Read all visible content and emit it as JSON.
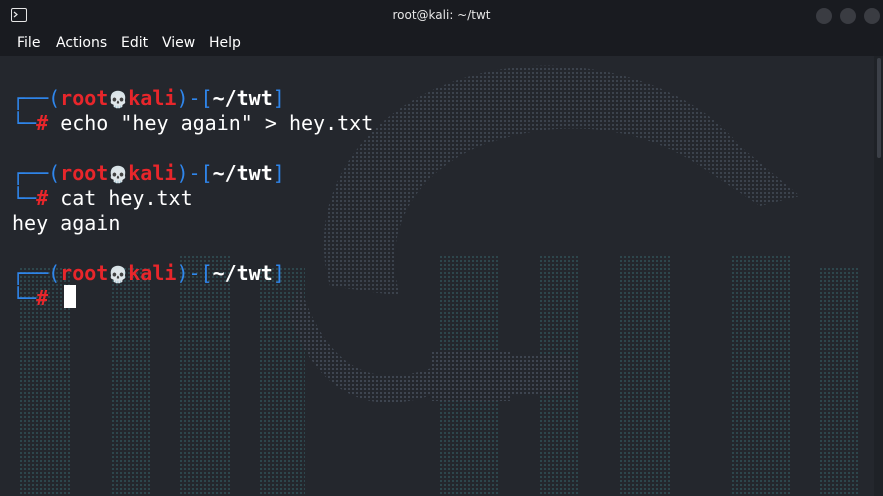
{
  "window": {
    "title": "root@kali: ~/twt"
  },
  "menu": [
    "File",
    "Actions",
    "Edit",
    "View",
    "Help"
  ],
  "prompt": {
    "user": "root",
    "skull": "💀",
    "host": "kali",
    "dir": "~/twt",
    "symbol": "#"
  },
  "lines": [
    {
      "type": "prompt",
      "command": "echo \"hey again\" > hey.txt"
    },
    {
      "type": "prompt",
      "command": "cat hey.txt"
    },
    {
      "type": "output",
      "text": "hey again"
    },
    {
      "type": "prompt",
      "command": ""
    }
  ],
  "commands": {
    "cmd1": "echo \"hey again\" > hey.txt",
    "cmd2": "cat hey.txt",
    "output1": "hey again"
  },
  "colors": {
    "prompt_blue": "#2f86ec",
    "prompt_red": "#e8262b",
    "background": "#24272d",
    "titlebar": "#191b20"
  }
}
